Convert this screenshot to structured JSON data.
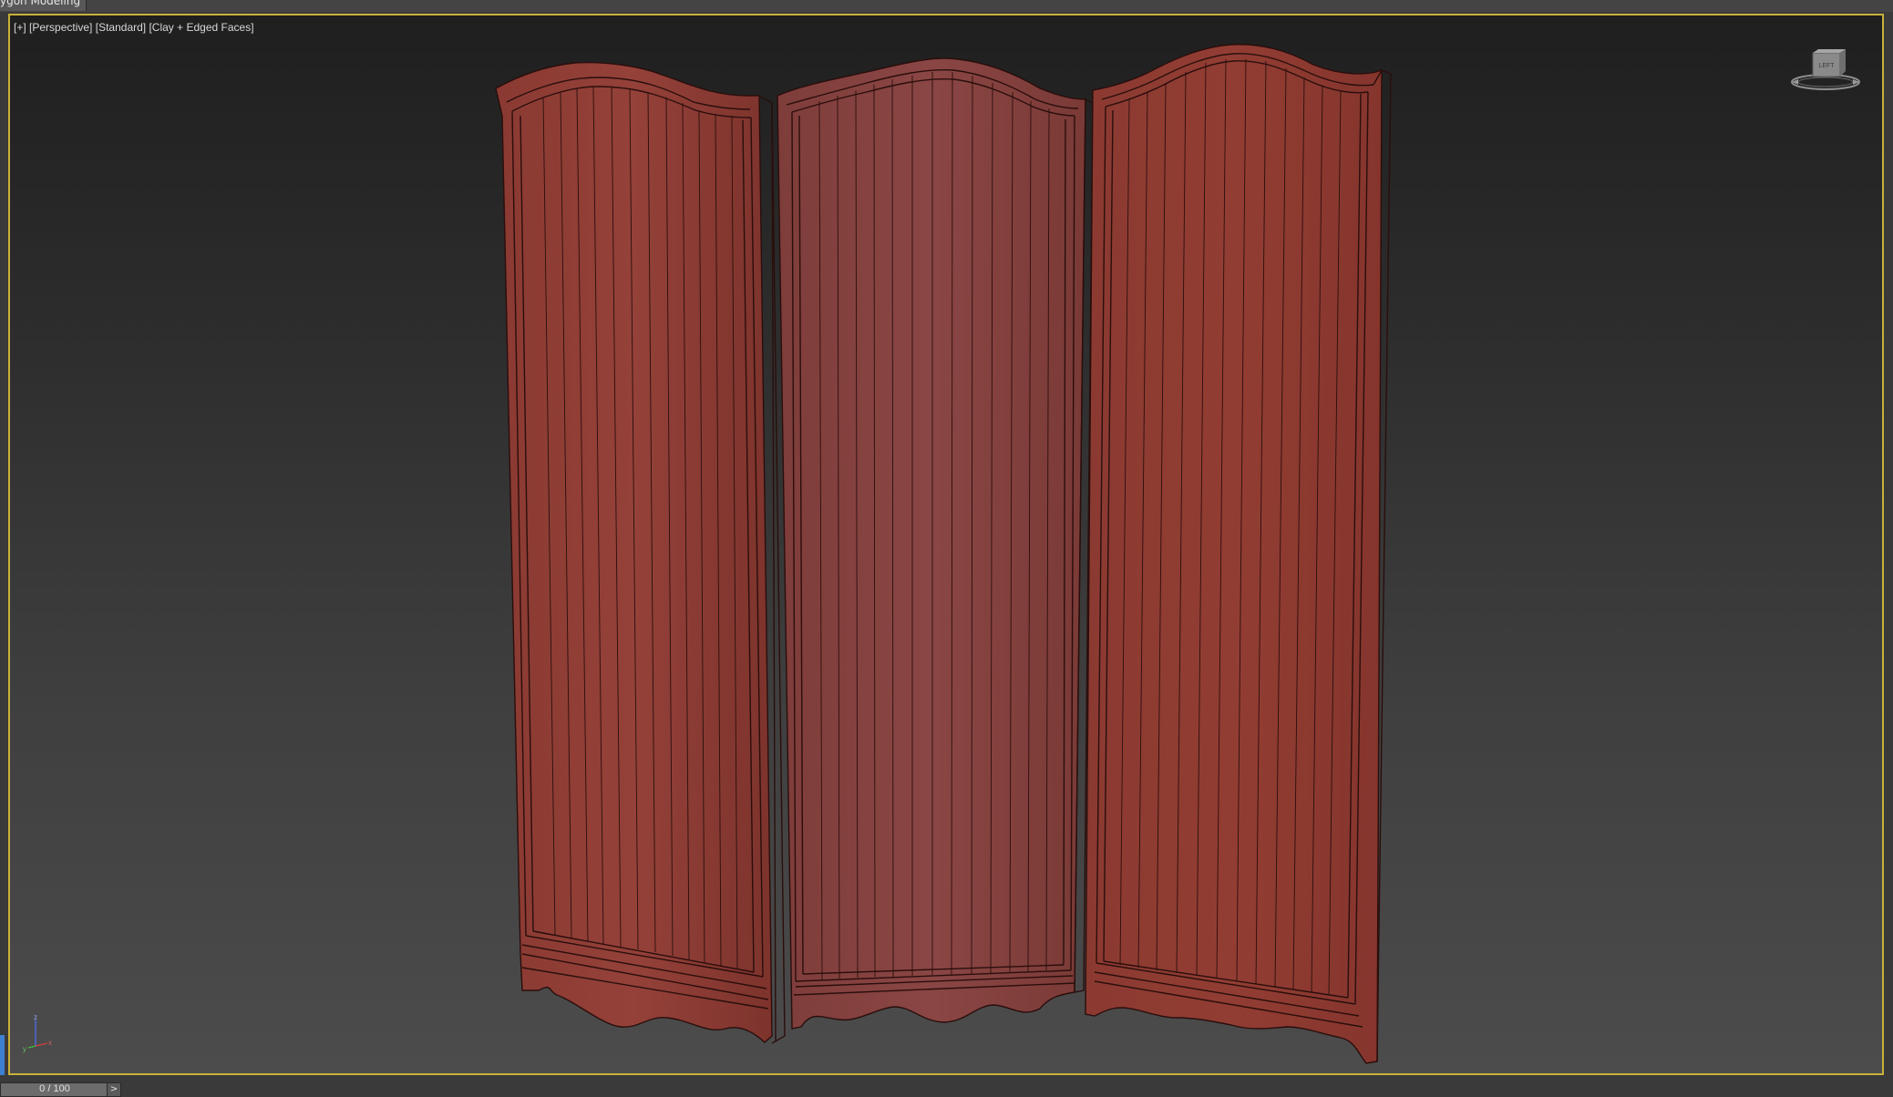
{
  "window": {
    "ribbon_tab": "ygon Modeling"
  },
  "viewport": {
    "labels": {
      "plus": "[+]",
      "view": "[Perspective]",
      "shading_std": "[Standard]",
      "shading_mode": "[Clay + Edged Faces]"
    },
    "object": "folding-screen-3-panel",
    "object_color": "#8f3d35",
    "edge_color": "#2a0e0c",
    "border_color": "#c9b13a",
    "viewcube_face": "LEFT",
    "axis_labels": {
      "x": "x",
      "y": "y",
      "z": "z"
    }
  },
  "timeline": {
    "frame_display": "0 / 100",
    "next_label": ">"
  }
}
